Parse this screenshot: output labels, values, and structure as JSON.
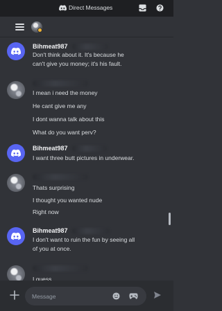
{
  "titlebar": {
    "title": "Direct Messages",
    "icons": [
      "discord-logo",
      "inbox-icon",
      "help-icon"
    ]
  },
  "header": {
    "icons": [
      "hamburger-menu-icon",
      "user-avatar"
    ]
  },
  "messages": [
    {
      "author": "Bihmeat987",
      "avatar": "discord-default-avatar",
      "lines": [
        "Don't think about it. It's because he",
        "can't give you money; it's his fault."
      ]
    },
    {
      "author": "",
      "avatar": "user-photo-avatar",
      "lines": [
        "I mean i need the money",
        "He cant give me any",
        "I dont wanna talk about this",
        "What do you want perv?"
      ]
    },
    {
      "author": "Bihmeat987",
      "avatar": "discord-default-avatar",
      "lines": [
        "I want three butt pictures in underwear."
      ]
    },
    {
      "author": "",
      "avatar": "user-photo-avatar",
      "lines": [
        "Thats surprising",
        "I thought you wanted nude",
        "Right now"
      ]
    },
    {
      "author": "Bihmeat987",
      "avatar": "discord-default-avatar",
      "lines": [
        "I don't want to ruin the fun by seeing all",
        "of you at once."
      ]
    },
    {
      "author": "",
      "avatar": "user-photo-avatar",
      "lines": [
        "I guess"
      ]
    }
  ],
  "composer": {
    "placeholder": "Message",
    "icons": [
      "plus-icon",
      "emoji-icon",
      "gamepad-icon",
      "send-icon"
    ]
  },
  "colors": {
    "background": "#313338",
    "titlebar": "#1e1f22",
    "composer": "#2b2d31",
    "blurple": "#5865f2",
    "text": "#dbdee1"
  }
}
